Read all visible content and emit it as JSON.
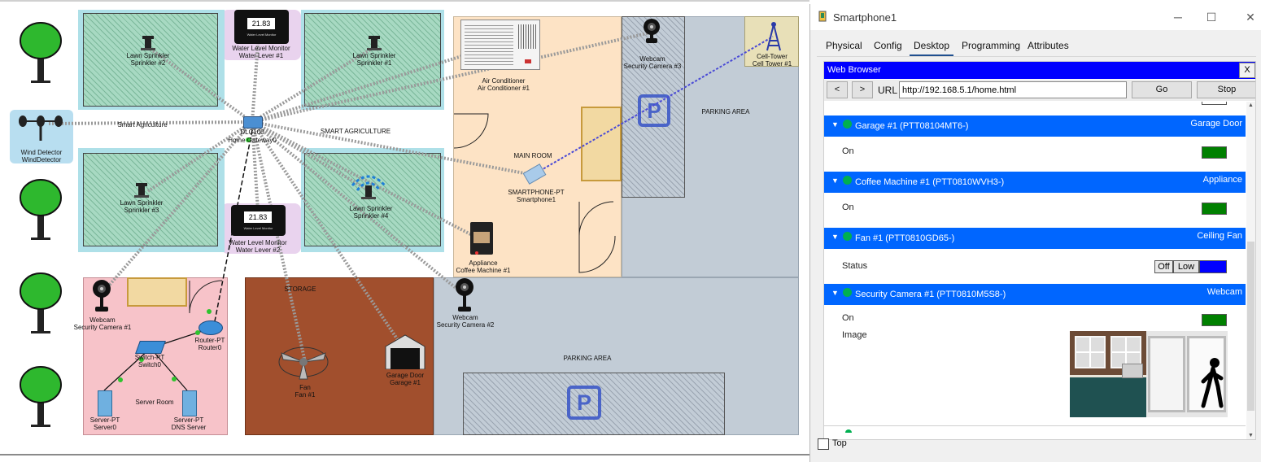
{
  "canvas": {
    "zones": {
      "smart_agriculture_left": "Smart Agriculture",
      "smart_agriculture_right": "SMART AGRICULTURE",
      "main_room": "MAIN ROOM",
      "parking_area_top": "PARKING AREA",
      "parking_area_bottom": "PARKING AREA",
      "storage": "STORAGE",
      "server_room": "Server Room",
      "parking_symbol": "P"
    },
    "devices": {
      "sprinkler2": {
        "type": "Lawn Sprinkler",
        "name": "Sprinkler #2"
      },
      "sprinkler1": {
        "type": "Lawn Sprinkler",
        "name": "Sprinkler #1"
      },
      "sprinkler3": {
        "type": "Lawn Sprinkler",
        "name": "Sprinkler #3"
      },
      "sprinkler4": {
        "type": "Lawn Sprinkler",
        "name": "Sprinkler #4"
      },
      "water1": {
        "type": "Water Level Monitor",
        "name": "Water Lever #1",
        "reading": "21.83",
        "caption": "Water Level Monitor"
      },
      "water2": {
        "type": "Water Level Monitor",
        "name": "Water Lever #2",
        "reading": "21.83",
        "caption": "Water Level Monitor"
      },
      "gateway": {
        "type": "DLC100",
        "name": "Home Gateway0"
      },
      "wind": {
        "type": "Wind Detector",
        "name": "WindDetector"
      },
      "ac": {
        "type": "Air Conditioner",
        "name": "Air Conditioner #1"
      },
      "cam3": {
        "type": "Webcam",
        "name": "Security Camera #3"
      },
      "tower": {
        "type": "Cell-Tower",
        "name": "Cell Tower #1"
      },
      "phone": {
        "type": "SMARTPHONE-PT",
        "name": "Smartphone1"
      },
      "coffee": {
        "type": "Appliance",
        "name": "Coffee Machine #1"
      },
      "cam1": {
        "type": "Webcam",
        "name": "Security Camera #1"
      },
      "cam2": {
        "type": "Webcam",
        "name": "Security Camera #2"
      },
      "router": {
        "type": "Router-PT",
        "name": "Router0"
      },
      "switch": {
        "type": "Switch-PT",
        "name": "Switch0"
      },
      "server0": {
        "type": "Server-PT",
        "name": "Server0"
      },
      "dns": {
        "type": "Server-PT",
        "name": "DNS Server"
      },
      "fan": {
        "type": "Fan",
        "name": "Fan #1"
      },
      "garage": {
        "type": "Garage Door",
        "name": "Garage #1"
      }
    }
  },
  "window": {
    "title": "Smartphone1",
    "tabs": [
      "Physical",
      "Config",
      "Desktop",
      "Programming",
      "Attributes"
    ],
    "active_tab": "Desktop",
    "browser": {
      "title": "Web Browser",
      "close": "X",
      "back": "<",
      "forward": ">",
      "url_label": "URL",
      "url": "http://192.168.5.1/home.html",
      "go": "Go",
      "stop": "Stop"
    },
    "things": [
      {
        "name": "Garage #1 (PTT08104MT6-)",
        "kind": "Garage Door",
        "prop": "On",
        "state": "on"
      },
      {
        "name": "Coffee Machine #1 (PTT0810WVH3-)",
        "kind": "Appliance",
        "prop": "On",
        "state": "on"
      },
      {
        "name": "Fan #1 (PTT0810GD65-)",
        "kind": "Ceiling Fan",
        "prop": "Status",
        "options": [
          "Off",
          "Low"
        ]
      },
      {
        "name": "Security Camera #1 (PTT0810M5S8-)",
        "kind": "Webcam",
        "prop": "On",
        "state": "on",
        "prop2": "Image"
      }
    ],
    "top_checkbox": "Top"
  },
  "colors": {
    "accent_blue": "#0066ff",
    "browser_bar": "#0000ff",
    "on_green": "#008000",
    "status_dot": "#00b050"
  }
}
